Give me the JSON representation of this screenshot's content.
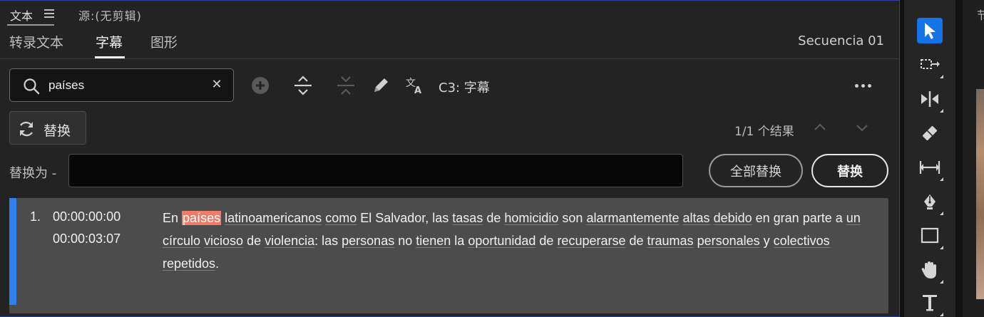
{
  "panel_tabs": {
    "text_tab": "文本",
    "source_tab": "源:(无剪辑)"
  },
  "subtabs": [
    {
      "label": "转录文本",
      "active": false
    },
    {
      "label": "字幕",
      "active": true
    },
    {
      "label": "图形",
      "active": false
    }
  ],
  "sequence": "Secuencia 01",
  "search": {
    "value": "países"
  },
  "toolbar_row": {
    "track_label": "C3: 字幕"
  },
  "replace": {
    "toggle_label": "替换",
    "label": "替换为 -",
    "value": "",
    "replace_all_label": "全部替换",
    "replace_label": "替换"
  },
  "results": {
    "count_text": "1/1 个结果"
  },
  "caption": {
    "index": "1.",
    "in": "00:00:00:00",
    "out": "00:00:03:07",
    "words": [
      {
        "t": "En",
        "s": "plain"
      },
      {
        "t": " ",
        "s": "plain"
      },
      {
        "t": "países",
        "s": "hl"
      },
      {
        "t": " ",
        "s": "plain"
      },
      {
        "t": "latinoamericanos",
        "s": "sp"
      },
      {
        "t": " ",
        "s": "plain"
      },
      {
        "t": "como",
        "s": "sp"
      },
      {
        "t": " El Salvador, las ",
        "s": "plain"
      },
      {
        "t": "tasas",
        "s": "sp"
      },
      {
        "t": " de ",
        "s": "plain"
      },
      {
        "t": "homicidio",
        "s": "sp"
      },
      {
        "t": " son ",
        "s": "plain"
      },
      {
        "t": "alarmantemente",
        "s": "sp"
      },
      {
        "t": " ",
        "s": "plain"
      },
      {
        "t": "altas",
        "s": "sp"
      },
      {
        "t": " ",
        "s": "plain"
      },
      {
        "t": "debido",
        "s": "sp"
      },
      {
        "t": " en gran parte a ",
        "s": "plain"
      },
      {
        "t": "un",
        "s": "sp"
      },
      {
        "t": " ",
        "s": "plain"
      },
      {
        "t": "círculo",
        "s": "sp"
      },
      {
        "t": " ",
        "s": "plain"
      },
      {
        "t": "vicioso",
        "s": "sp"
      },
      {
        "t": " de ",
        "s": "plain"
      },
      {
        "t": "violencia",
        "s": "sp"
      },
      {
        "t": ": las ",
        "s": "plain"
      },
      {
        "t": "personas",
        "s": "sp"
      },
      {
        "t": " no ",
        "s": "plain"
      },
      {
        "t": "tienen",
        "s": "sp"
      },
      {
        "t": " la ",
        "s": "plain"
      },
      {
        "t": "oportunidad",
        "s": "sp"
      },
      {
        "t": " de ",
        "s": "plain"
      },
      {
        "t": "recuperarse",
        "s": "sp"
      },
      {
        "t": " de ",
        "s": "plain"
      },
      {
        "t": "traumas",
        "s": "sp"
      },
      {
        "t": " ",
        "s": "plain"
      },
      {
        "t": "personales",
        "s": "sp"
      },
      {
        "t": " y ",
        "s": "plain"
      },
      {
        "t": "colectivos",
        "s": "sp"
      },
      {
        "t": " ",
        "s": "plain"
      },
      {
        "t": "repetidos",
        "s": "sp"
      },
      {
        "t": ".",
        "s": "plain"
      }
    ]
  },
  "right_panel": {
    "title": "节"
  },
  "colors": {
    "accent": "#2f80ed",
    "highlight": "#ef7b69",
    "tool_active": "#1473e6"
  },
  "tools": [
    "selection-tool-icon",
    "track-select-tool-icon",
    "ripple-edit-tool-icon",
    "razor-tool-icon",
    "slip-tool-icon",
    "pen-tool-icon",
    "rectangle-tool-icon",
    "hand-tool-icon",
    "type-tool-icon"
  ]
}
